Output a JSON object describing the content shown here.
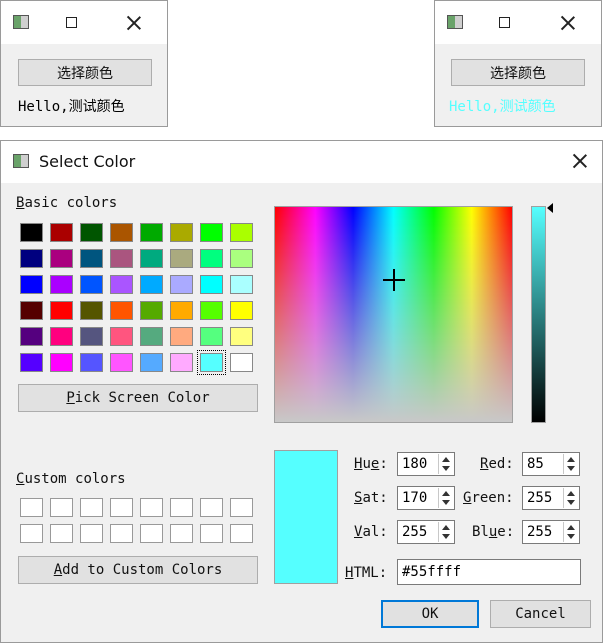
{
  "window_left": {
    "button_label": "选择颜色",
    "text": "Hello,测试颜色",
    "text_color": "#000000"
  },
  "window_right": {
    "button_label": "选择颜色",
    "text": "Hello,测试颜色",
    "text_color": "#55ffff"
  },
  "dialog": {
    "title": "Select Color",
    "basic_colors_label": "Basic colors",
    "pick_screen_color_label": "Pick Screen Color",
    "custom_colors_label": "Custom colors",
    "add_custom_label": "Add to Custom Colors",
    "html_label": "HTML:",
    "html_value": "#55ffff",
    "ok_label": "OK",
    "cancel_label": "Cancel",
    "selected_color": "#55ffff",
    "fields": {
      "hue": {
        "label": "Hue:",
        "value": "180"
      },
      "sat": {
        "label": "Sat:",
        "value": "170"
      },
      "val": {
        "label": "Val:",
        "value": "255"
      },
      "red": {
        "label": "Red:",
        "value": "85"
      },
      "green": {
        "label": "Green:",
        "value": "255"
      },
      "blue": {
        "label": "Blue:",
        "value": "255"
      }
    },
    "basic_colors": [
      "#000000",
      "#aa0000",
      "#005500",
      "#aa5500",
      "#00aa00",
      "#aaaa00",
      "#00ff00",
      "#aaff00",
      "#00007f",
      "#aa007f",
      "#00557f",
      "#aa557f",
      "#00aa7f",
      "#aaaa7f",
      "#00ff7f",
      "#aaff7f",
      "#0000ff",
      "#aa00ff",
      "#0055ff",
      "#aa55ff",
      "#00aaff",
      "#aaaaff",
      "#00ffff",
      "#aaffff",
      "#550000",
      "#ff0000",
      "#555500",
      "#ff5500",
      "#55aa00",
      "#ffaa00",
      "#55ff00",
      "#ffff00",
      "#55007f",
      "#ff007f",
      "#55557f",
      "#ff557f",
      "#55aa7f",
      "#ffaa7f",
      "#55ff7f",
      "#ffff7f",
      "#5500ff",
      "#ff00ff",
      "#5555ff",
      "#ff55ff",
      "#55aaff",
      "#ffaaff",
      "#55ffff",
      "#ffffff"
    ],
    "selected_basic_index": 46
  }
}
